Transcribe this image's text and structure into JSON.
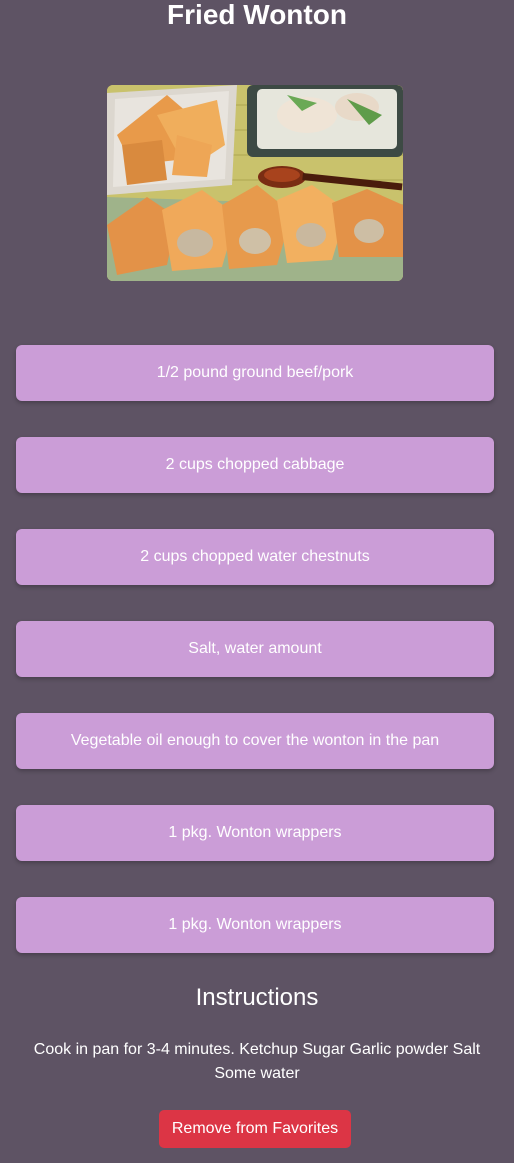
{
  "recipe": {
    "title": "Fried Wonton",
    "image_icon": "fried-wonton-photo"
  },
  "ingredients": [
    "1/2 pound ground beef/pork",
    "2 cups chopped cabbage",
    "2 cups chopped water chestnuts",
    "Salt, water amount",
    "Vegetable oil enough to cover the wonton in the pan",
    "1 pkg. Wonton wrappers",
    "1 pkg. Wonton wrappers"
  ],
  "instructions": {
    "heading": "Instructions",
    "text": "Cook in pan for 3-4 minutes. Ketchup Sugar Garlic powder Salt Some water"
  },
  "actions": {
    "remove_label": "Remove from Favorites"
  },
  "colors": {
    "background": "#5e5364",
    "ingredient_card": "#cb9dd7",
    "remove_button": "#dc3545"
  }
}
